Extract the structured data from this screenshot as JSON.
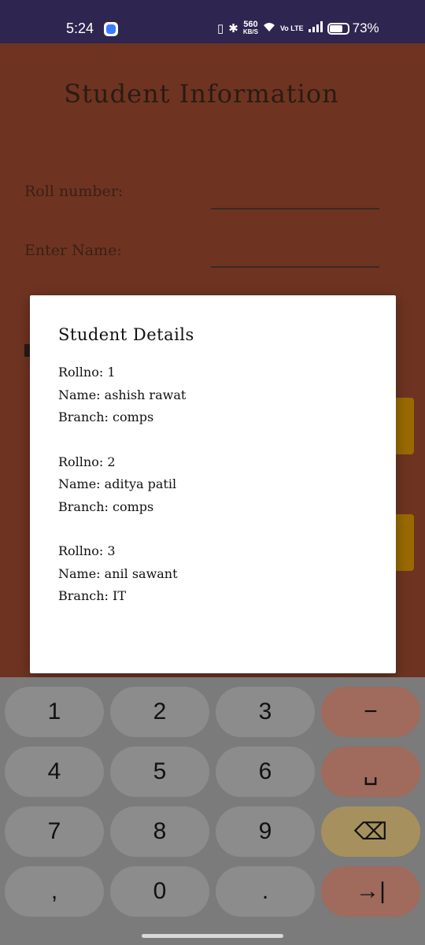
{
  "status_bar": {
    "time": "5:24",
    "speed_value": "560",
    "speed_unit": "KB/S",
    "network": "Vo LTE",
    "battery": "73%"
  },
  "app": {
    "title": "Student Information",
    "fields": {
      "roll_label": "Roll number:",
      "name_label": "Enter Name:"
    }
  },
  "dialog": {
    "title": "Student Details",
    "records": [
      {
        "rollno": "Rollno: 1",
        "name": "Name: ashish rawat",
        "branch": "Branch: comps"
      },
      {
        "rollno": "Rollno: 2",
        "name": "Name: aditya patil",
        "branch": "Branch: comps"
      },
      {
        "rollno": "Rollno: 3",
        "name": "Name: anil sawant",
        "branch": "Branch: IT"
      }
    ]
  },
  "keyboard": {
    "keys": [
      "1",
      "2",
      "3",
      "−",
      "4",
      "5",
      "6",
      "␣",
      "7",
      "8",
      "9",
      "⌫",
      ",",
      "0",
      ".",
      "→|"
    ]
  }
}
